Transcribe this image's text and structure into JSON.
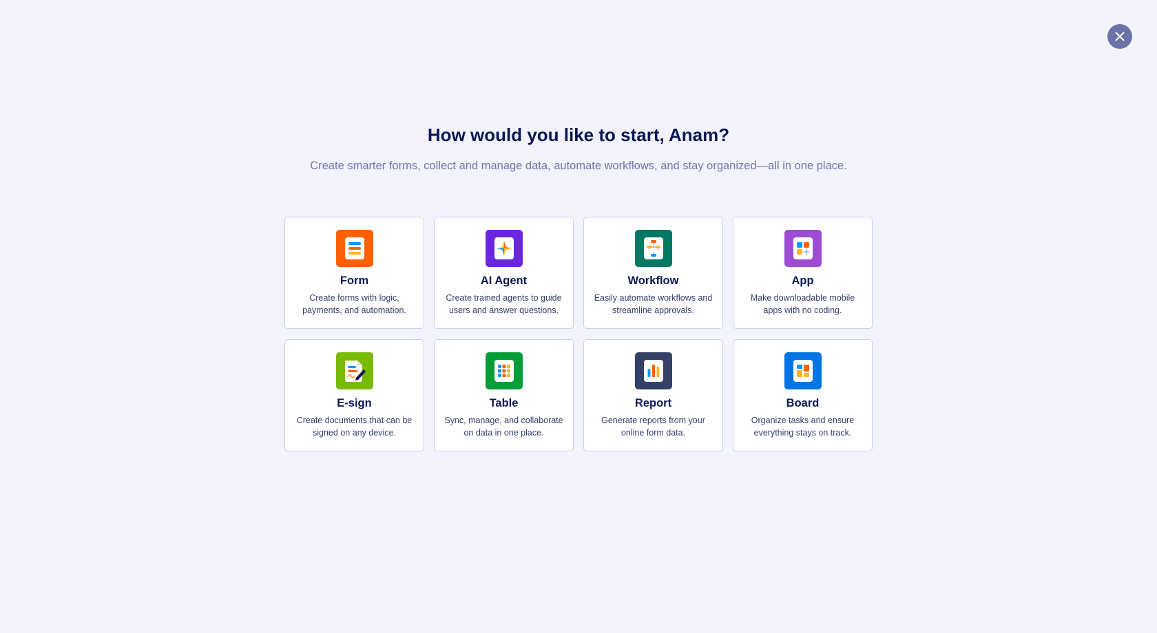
{
  "close": {
    "label": "Close",
    "icon": "close-icon"
  },
  "header": {
    "title": "How would you like to start, Anam?",
    "subtitle": "Create smarter forms, collect and manage data, automate workflows, and stay organized—all in one place."
  },
  "options": [
    {
      "title": "Form",
      "description": "Create forms with logic, payments, and automation.",
      "icon": "form-icon",
      "color": "#ff6100"
    },
    {
      "title": "AI Agent",
      "description": "Create trained agents to guide users and answer questions.",
      "icon": "ai-agent-icon",
      "color": "#6a26df"
    },
    {
      "title": "Workflow",
      "description": "Easily automate workflows and streamline approvals.",
      "icon": "workflow-icon",
      "color": "#007862"
    },
    {
      "title": "App",
      "description": "Make downloadable mobile apps with no coding.",
      "icon": "app-icon",
      "color": "#9c4dd3"
    },
    {
      "title": "E-sign",
      "description": "Create documents that can be signed on any device.",
      "icon": "e-sign-icon",
      "color": "#78bb07"
    },
    {
      "title": "Table",
      "description": "Sync, manage, and collaborate on data in one place.",
      "icon": "table-icon",
      "color": "#049e38"
    },
    {
      "title": "Report",
      "description": "Generate reports from your online form data.",
      "icon": "report-icon",
      "color": "#344067"
    },
    {
      "title": "Board",
      "description": "Organize tasks and ensure everything stays on track.",
      "icon": "board-icon",
      "color": "#0075e3"
    }
  ]
}
